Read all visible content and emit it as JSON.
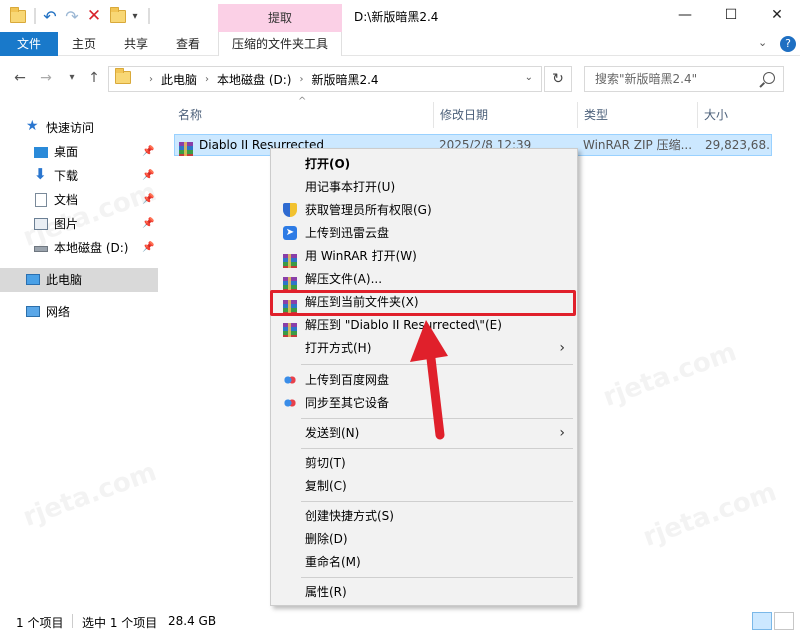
{
  "titlebar": {
    "contextual_tab": "提取",
    "window_title": "D:\\新版暗黑2.4",
    "minimize": "—",
    "maximize": "☐",
    "close": "✕"
  },
  "ribbon": {
    "tabs": [
      "文件",
      "主页",
      "共享",
      "查看",
      "压缩的文件夹工具"
    ]
  },
  "address": {
    "crumbs": [
      "此电脑",
      "本地磁盘 (D:)",
      "新版暗黑2.4"
    ],
    "search_placeholder": "搜索\"新版暗黑2.4\""
  },
  "sidebar": {
    "items": [
      {
        "label": "快速访问",
        "icon": "star-icon"
      },
      {
        "label": "桌面",
        "icon": "desktop-icon"
      },
      {
        "label": "下载",
        "icon": "download-icon"
      },
      {
        "label": "文档",
        "icon": "document-icon"
      },
      {
        "label": "图片",
        "icon": "picture-icon"
      },
      {
        "label": "本地磁盘 (D:)",
        "icon": "drive-icon"
      },
      {
        "label": "此电脑",
        "icon": "computer-icon"
      },
      {
        "label": "网络",
        "icon": "network-icon"
      }
    ]
  },
  "columns": {
    "name": "名称",
    "date": "修改日期",
    "type": "类型",
    "size": "大小"
  },
  "file": {
    "name": "Diablo II Resurrected",
    "date": "2025/2/8 12:39",
    "type": "WinRAR ZIP 压缩...",
    "size": "29,823,68..."
  },
  "context_menu": {
    "items": [
      {
        "label": "打开(O)",
        "icon": ""
      },
      {
        "label": "用记事本打开(U)",
        "icon": ""
      },
      {
        "label": "获取管理员所有权限(G)",
        "icon": "shield-icon"
      },
      {
        "label": "上传到迅雷云盘",
        "icon": "thunder-icon"
      },
      {
        "label": "用 WinRAR 打开(W)",
        "icon": "winrar-icon"
      },
      {
        "label": "解压文件(A)...",
        "icon": "winrar-icon"
      },
      {
        "label": "解压到当前文件夹(X)",
        "icon": "winrar-icon"
      },
      {
        "label": "解压到 \"Diablo II Resurrected\\\"(E)",
        "icon": "winrar-icon"
      },
      {
        "label": "打开方式(H)",
        "icon": ""
      },
      {
        "label": "上传到百度网盘",
        "icon": "baidu-cloud-icon"
      },
      {
        "label": "同步至其它设备",
        "icon": "baidu-cloud-icon"
      },
      {
        "label": "发送到(N)",
        "icon": ""
      },
      {
        "label": "剪切(T)",
        "icon": ""
      },
      {
        "label": "复制(C)",
        "icon": ""
      },
      {
        "label": "创建快捷方式(S)",
        "icon": ""
      },
      {
        "label": "删除(D)",
        "icon": ""
      },
      {
        "label": "重命名(M)",
        "icon": ""
      },
      {
        "label": "属性(R)",
        "icon": ""
      }
    ],
    "highlight_color": "#e0202b"
  },
  "status": {
    "count": "1 个项目",
    "selected": "选中 1 个项目",
    "size": "28.4 GB"
  }
}
